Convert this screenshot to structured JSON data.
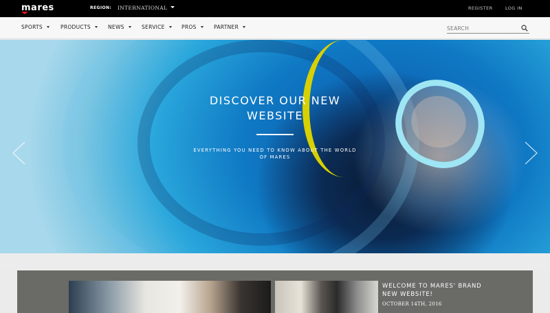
{
  "topbar": {
    "logo": "mares",
    "region_label": "REGION:",
    "region_value": "INTERNATIONAL",
    "register": "REGISTER",
    "login": "LOG IN"
  },
  "nav": {
    "items": [
      {
        "label": "SPORTS"
      },
      {
        "label": "PRODUCTS"
      },
      {
        "label": "NEWS"
      },
      {
        "label": "SERVICE"
      },
      {
        "label": "PROS"
      },
      {
        "label": "PARTNER"
      }
    ],
    "search_placeholder": "SEARCH"
  },
  "hero": {
    "title": "DISCOVER OUR NEW WEBSITE",
    "subtitle": "EVERYTHING YOU NEED TO KNOW ABOUT THE WORLD OF MARES"
  },
  "news": {
    "title": "WELCOME TO MARES' BRAND NEW WEBSITE!",
    "date": "OCTOBER 14TH, 2016"
  },
  "colors": {
    "topbar_bg": "#000000",
    "accent_red": "#e4151b",
    "hero_blue": "#0f79c4",
    "panel_gray": "#6a6a67"
  },
  "icons": {
    "search": "search-icon",
    "prev": "chevron-left-icon",
    "next": "chevron-right-icon"
  }
}
